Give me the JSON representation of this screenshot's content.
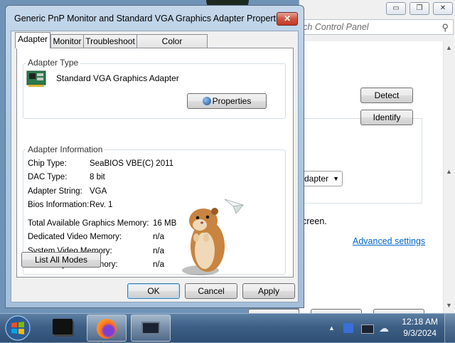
{
  "dialog": {
    "title": "Generic PnP Monitor and Standard VGA Graphics Adapter Properties",
    "close_glyph": "✕",
    "tabs": [
      {
        "label": "Adapter",
        "active": true
      },
      {
        "label": "Monitor",
        "active": false
      },
      {
        "label": "Troubleshoot",
        "active": false
      },
      {
        "label": "Color Management",
        "active": false
      }
    ],
    "adapter_type": {
      "group_label": "Adapter Type",
      "name": "Standard VGA Graphics Adapter",
      "properties_button": "Properties"
    },
    "adapter_info": {
      "group_label": "Adapter Information",
      "chip_type_label": "Chip Type:",
      "chip_type_value": "SeaBIOS VBE(C) 2011",
      "dac_type_label": "DAC Type:",
      "dac_type_value": "8 bit",
      "adapter_string_label": "Adapter String:",
      "adapter_string_value": "VGA",
      "bios_info_label": "Bios Information:",
      "bios_info_value": "Rev. 1"
    },
    "memory": {
      "total_label": "Total Available Graphics Memory:",
      "total_value": "16 MB",
      "dedicated_label": "Dedicated Video Memory:",
      "dedicated_value": "n/a",
      "system_label": "System Video Memory:",
      "system_value": "n/a",
      "shared_label": "Shared System Memory:",
      "shared_value": "n/a"
    },
    "list_modes_button": "List All Modes",
    "ok_button": "OK",
    "cancel_button": "Cancel",
    "apply_button": "Apply"
  },
  "background_window": {
    "search_placeholder": "rch Control Panel",
    "detect_button": "Detect",
    "identify_button": "Identify",
    "dropdown_text": "dapter",
    "screen_text": "creen.",
    "advanced_link": "Advanced settings",
    "minimize_glyph": "▭",
    "restore_glyph": "❐",
    "close_glyph": "✕"
  },
  "taskbar": {
    "time": "12:18 AM",
    "date": "9/3/2024"
  },
  "colors": {
    "link": "#0066cc",
    "taskbar": "#3d5f85",
    "close_button": "#c8452f"
  }
}
